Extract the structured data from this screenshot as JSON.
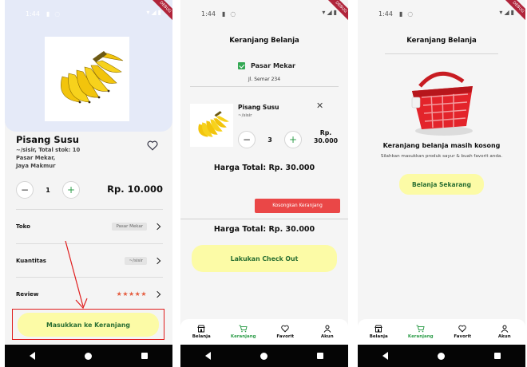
{
  "status_bar": {
    "time": "1:44"
  },
  "debug_ribbon": "DEBUG",
  "product_screen": {
    "name": "Pisang Susu",
    "unit_stock": "~/sisir, Total stok: 10",
    "store_line": "Pasar Mekar,",
    "address_line": "Jaya Makmur",
    "quantity": "1",
    "price": "Rp. 10.000",
    "rows": [
      {
        "label": "Toko",
        "chip": "Pasar Mekar"
      },
      {
        "label": "Kuantitas",
        "chip": "~/sisir"
      },
      {
        "label": "Review",
        "stars": "★★★★★"
      }
    ],
    "add_to_cart_label": "Masukkan ke Keranjang"
  },
  "cart_screen": {
    "title": "Keranjang Belanja",
    "store_name": "Pasar Mekar",
    "store_address": "Jl. Semar 234",
    "item": {
      "name": "Pisang Susu",
      "unit": "~/sisir",
      "quantity": "3",
      "price_line1": "Rp.",
      "price_line2": "30.000"
    },
    "total_label": "Harga Total: Rp. 30.000",
    "clear_cart_label": "Kosongkan Keranjang",
    "total_label_2": "Harga Total: Rp. 30.000",
    "checkout_label": "Lakukan Check Out"
  },
  "empty_cart_screen": {
    "title": "Keranjang Belanja",
    "empty_message": "Keranjang belanja masih kosong",
    "hint": "Silahkan masukkan produk sayur & buah favorit anda.",
    "shop_now_label": "Belanja Sekarang"
  },
  "bottom_tabs": [
    {
      "label": "Belanja",
      "icon": "shop-icon"
    },
    {
      "label": "Keranjang",
      "icon": "cart-icon",
      "active": true
    },
    {
      "label": "Favorit",
      "icon": "heart-icon"
    },
    {
      "label": "Akun",
      "icon": "person-icon"
    }
  ],
  "colors": {
    "accent_green": "#2e9d4a",
    "button_yellow": "#fcfba6",
    "danger_red": "#ea4747",
    "hero_bg": "#e5eaf8"
  }
}
